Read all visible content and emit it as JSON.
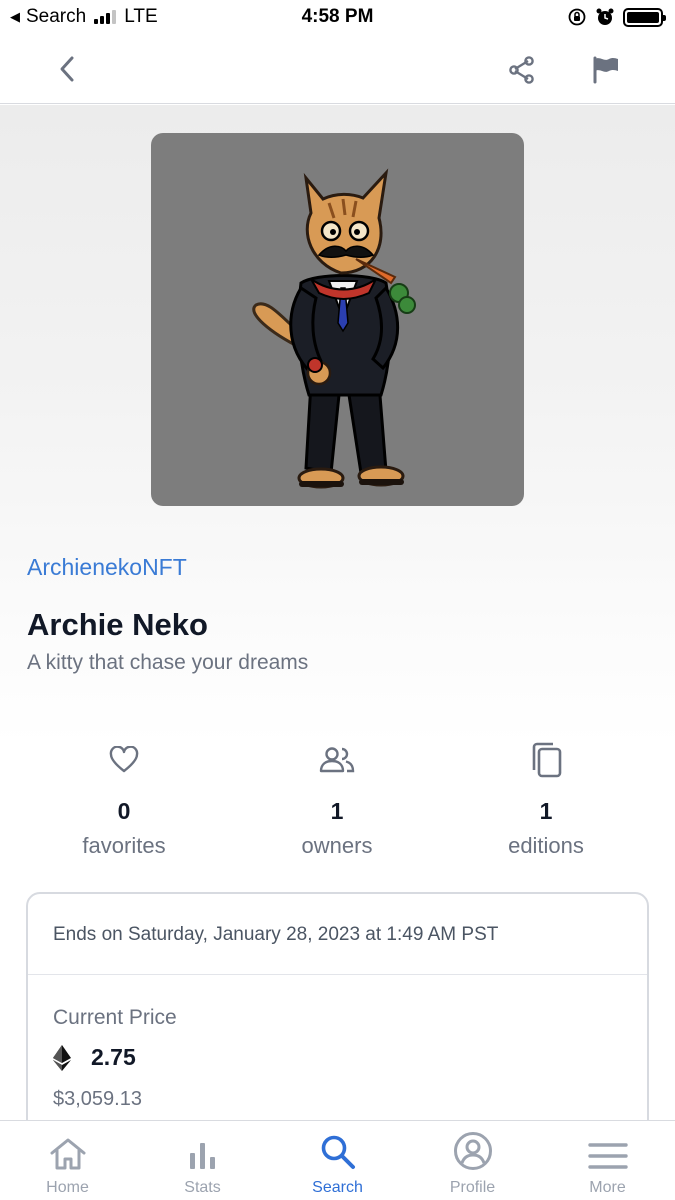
{
  "status_bar": {
    "back_app": "Search",
    "network": "LTE",
    "time": "4:58 PM"
  },
  "creator": "ArchienekoNFT",
  "title": "Archie Neko",
  "description": "A kitty that chase your dreams",
  "stats": [
    {
      "icon": "heart-icon",
      "value": "0",
      "label": "favorites"
    },
    {
      "icon": "owners-icon",
      "value": "1",
      "label": "owners"
    },
    {
      "icon": "copy-icon",
      "value": "1",
      "label": "editions"
    }
  ],
  "auction": {
    "ends_text": "Ends on Saturday, January 28, 2023 at 1:49 AM PST",
    "current_price_label": "Current Price",
    "eth_value": "2.75",
    "usd_value": "$3,059.13"
  },
  "tabs": [
    {
      "icon": "home-icon",
      "label": "Home"
    },
    {
      "icon": "stats-icon",
      "label": "Stats"
    },
    {
      "icon": "search-icon",
      "label": "Search",
      "active": true
    },
    {
      "icon": "profile-icon",
      "label": "Profile"
    },
    {
      "icon": "menu-icon",
      "label": "More"
    }
  ],
  "colors": {
    "accent": "#3a7bd5",
    "active_tab": "#2f6fd6",
    "icon_gray": "#6b7280",
    "artwork_bg": "#7d7d7d"
  }
}
